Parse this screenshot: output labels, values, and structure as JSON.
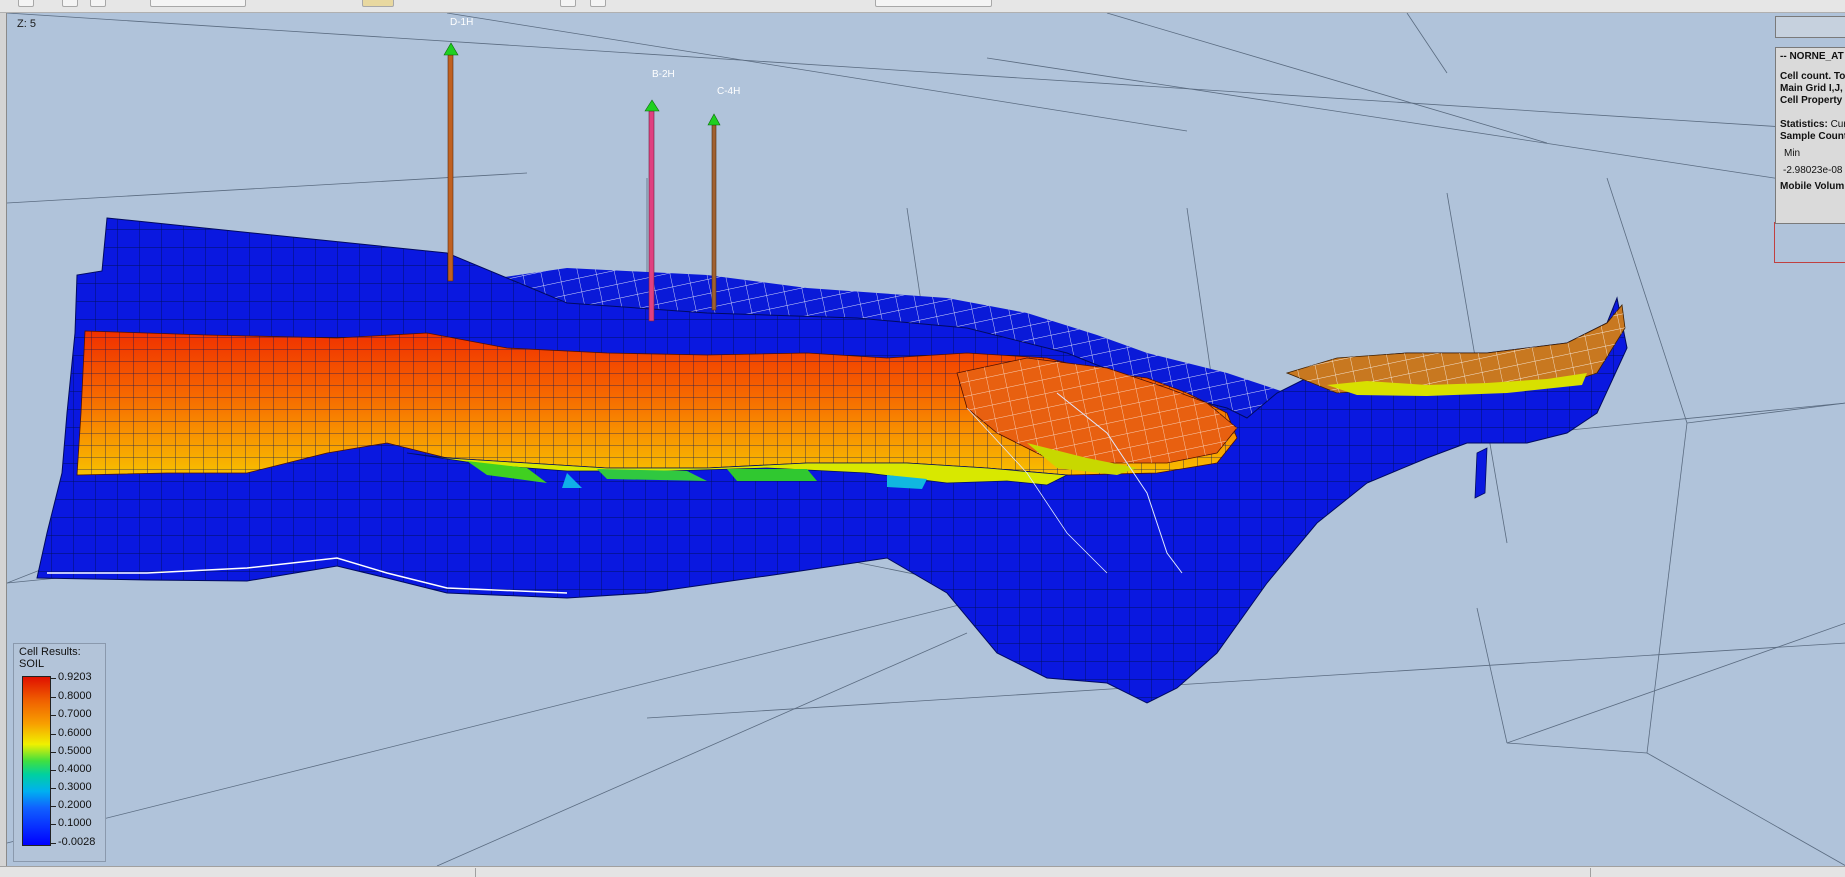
{
  "viewport": {
    "zoom_label": "Z: 5",
    "background_color": "#b0c3da"
  },
  "wells": [
    {
      "name": "D-1H",
      "color": "#c06020"
    },
    {
      "name": "B-2H",
      "color": "#e04080"
    },
    {
      "name": "C-4H",
      "color": "#a06030"
    }
  ],
  "legend": {
    "title_line1": "Cell Results:",
    "title_line2": "SOIL",
    "labels": [
      "0.9203",
      "0.8000",
      "0.7000",
      "0.6000",
      "0.5000",
      "0.4000",
      "0.3000",
      "0.2000",
      "0.1000",
      "-0.0028"
    ]
  },
  "info_panel": {
    "title": "-- NORNE_AT",
    "cell_count": "Cell count. To",
    "main_grid": "Main Grid I,J,",
    "cell_property": "Cell Property",
    "statistics_label": "Statistics:",
    "statistics_value": "Cur",
    "sample_count": "Sample Count",
    "min_label": "Min",
    "min_value": "-2.98023e-08",
    "mobile_volume": "Mobile Volum"
  }
}
